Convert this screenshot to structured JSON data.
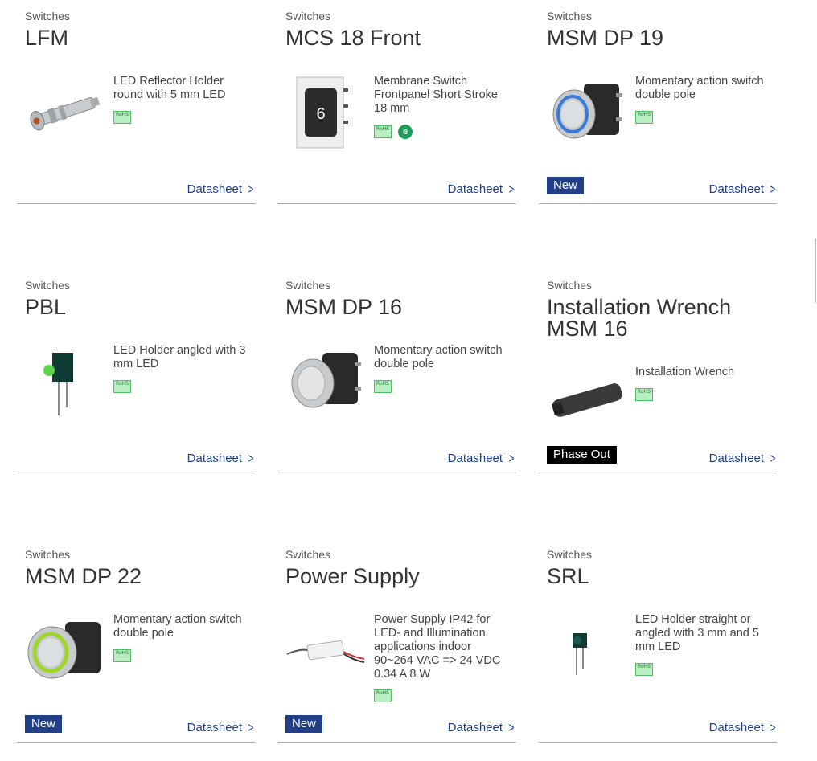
{
  "products": [
    {
      "category": "Switches",
      "title": "LFM",
      "description": "LED Reflector Holder round with 5 mm LED",
      "badges": [
        "rohs"
      ],
      "flag": "",
      "datasheet_label": "Datasheet"
    },
    {
      "category": "Switches",
      "title": "MCS 18 Front",
      "description": "Membrane Switch Frontpanel Short Stroke 18 mm",
      "badges": [
        "rohs",
        "eco"
      ],
      "flag": "",
      "datasheet_label": "Datasheet",
      "key_digit": "6"
    },
    {
      "category": "Switches",
      "title": "MSM DP 19",
      "description": "Momentary action switch double pole",
      "badges": [
        "rohs"
      ],
      "flag": "New",
      "datasheet_label": "Datasheet"
    },
    {
      "category": "Switches",
      "title": "PBL",
      "description": "LED Holder angled with 3 mm LED",
      "badges": [
        "rohs"
      ],
      "flag": "",
      "datasheet_label": "Datasheet"
    },
    {
      "category": "Switches",
      "title": "MSM DP 16",
      "description": "Momentary action switch double pole",
      "badges": [
        "rohs"
      ],
      "flag": "",
      "datasheet_label": "Datasheet"
    },
    {
      "category": "Switches",
      "title": "Installation Wrench MSM 16",
      "description": "Installation Wrench",
      "badges": [
        "rohs"
      ],
      "flag": "Phase Out",
      "datasheet_label": "Datasheet"
    },
    {
      "category": "Switches",
      "title": "MSM DP 22",
      "description": "Momentary action switch double pole",
      "badges": [
        "rohs"
      ],
      "flag": "New",
      "datasheet_label": "Datasheet"
    },
    {
      "category": "Switches",
      "title": "Power Supply",
      "description": "Power Supply IP42 for LED- and Illumination applications indoor 90~264 VAC => 24 VDC 0.34 A 8 W",
      "badges": [
        "rohs"
      ],
      "flag": "New",
      "datasheet_label": "Datasheet"
    },
    {
      "category": "Switches",
      "title": "SRL",
      "description": "LED Holder straight or angled with 3 mm and 5 mm LED",
      "badges": [
        "rohs"
      ],
      "flag": "",
      "datasheet_label": "Datasheet"
    }
  ],
  "badge_labels": {
    "rohs": "RoHS",
    "eco": "e"
  },
  "colors": {
    "link": "#1d3f8f",
    "new_flag": "#213f86",
    "phase_out_flag": "#000000",
    "rule": "#a9a9a9"
  }
}
